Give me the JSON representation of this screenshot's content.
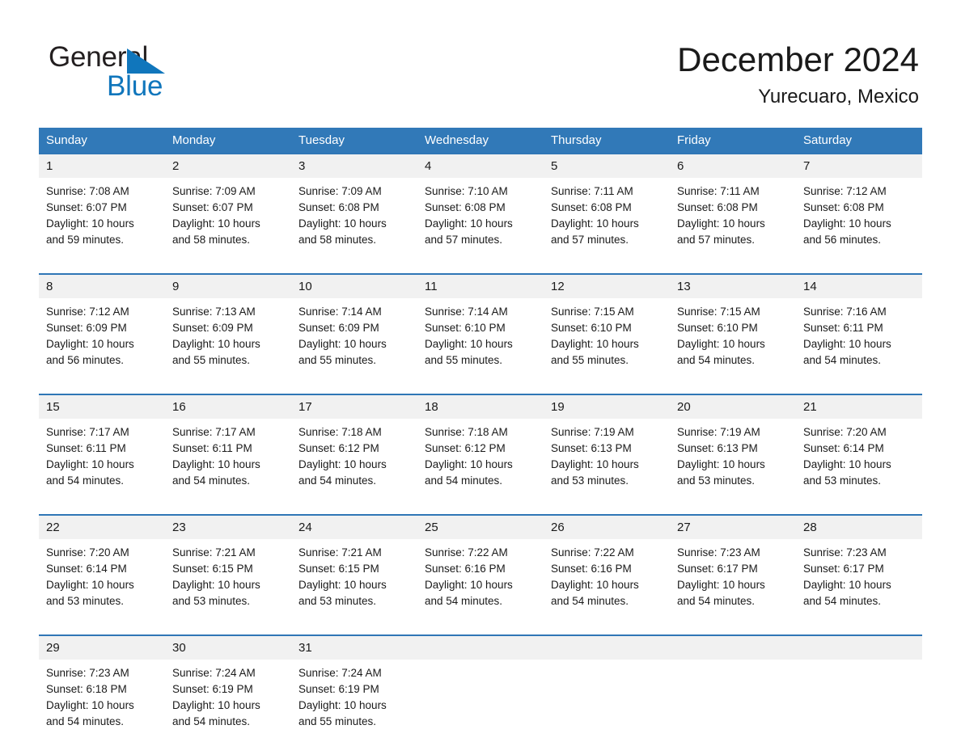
{
  "brand": {
    "name_top": "General",
    "name_bottom": "Blue",
    "color_primary": "#1076bc",
    "color_text": "#231f20"
  },
  "header": {
    "title": "December 2024",
    "subtitle": "Yurecuaro, Mexico"
  },
  "theme": {
    "header_row_bg": "#3179b8",
    "separator": "#2f76b6",
    "daynum_bg": "#f1f1f1",
    "page_bg": "#ffffff"
  },
  "weekdays": [
    "Sunday",
    "Monday",
    "Tuesday",
    "Wednesday",
    "Thursday",
    "Friday",
    "Saturday"
  ],
  "weeks": [
    [
      {
        "day": "1",
        "sunrise": "Sunrise: 7:08 AM",
        "sunset": "Sunset: 6:07 PM",
        "daylight1": "Daylight: 10 hours",
        "daylight2": "and 59 minutes."
      },
      {
        "day": "2",
        "sunrise": "Sunrise: 7:09 AM",
        "sunset": "Sunset: 6:07 PM",
        "daylight1": "Daylight: 10 hours",
        "daylight2": "and 58 minutes."
      },
      {
        "day": "3",
        "sunrise": "Sunrise: 7:09 AM",
        "sunset": "Sunset: 6:08 PM",
        "daylight1": "Daylight: 10 hours",
        "daylight2": "and 58 minutes."
      },
      {
        "day": "4",
        "sunrise": "Sunrise: 7:10 AM",
        "sunset": "Sunset: 6:08 PM",
        "daylight1": "Daylight: 10 hours",
        "daylight2": "and 57 minutes."
      },
      {
        "day": "5",
        "sunrise": "Sunrise: 7:11 AM",
        "sunset": "Sunset: 6:08 PM",
        "daylight1": "Daylight: 10 hours",
        "daylight2": "and 57 minutes."
      },
      {
        "day": "6",
        "sunrise": "Sunrise: 7:11 AM",
        "sunset": "Sunset: 6:08 PM",
        "daylight1": "Daylight: 10 hours",
        "daylight2": "and 57 minutes."
      },
      {
        "day": "7",
        "sunrise": "Sunrise: 7:12 AM",
        "sunset": "Sunset: 6:08 PM",
        "daylight1": "Daylight: 10 hours",
        "daylight2": "and 56 minutes."
      }
    ],
    [
      {
        "day": "8",
        "sunrise": "Sunrise: 7:12 AM",
        "sunset": "Sunset: 6:09 PM",
        "daylight1": "Daylight: 10 hours",
        "daylight2": "and 56 minutes."
      },
      {
        "day": "9",
        "sunrise": "Sunrise: 7:13 AM",
        "sunset": "Sunset: 6:09 PM",
        "daylight1": "Daylight: 10 hours",
        "daylight2": "and 55 minutes."
      },
      {
        "day": "10",
        "sunrise": "Sunrise: 7:14 AM",
        "sunset": "Sunset: 6:09 PM",
        "daylight1": "Daylight: 10 hours",
        "daylight2": "and 55 minutes."
      },
      {
        "day": "11",
        "sunrise": "Sunrise: 7:14 AM",
        "sunset": "Sunset: 6:10 PM",
        "daylight1": "Daylight: 10 hours",
        "daylight2": "and 55 minutes."
      },
      {
        "day": "12",
        "sunrise": "Sunrise: 7:15 AM",
        "sunset": "Sunset: 6:10 PM",
        "daylight1": "Daylight: 10 hours",
        "daylight2": "and 55 minutes."
      },
      {
        "day": "13",
        "sunrise": "Sunrise: 7:15 AM",
        "sunset": "Sunset: 6:10 PM",
        "daylight1": "Daylight: 10 hours",
        "daylight2": "and 54 minutes."
      },
      {
        "day": "14",
        "sunrise": "Sunrise: 7:16 AM",
        "sunset": "Sunset: 6:11 PM",
        "daylight1": "Daylight: 10 hours",
        "daylight2": "and 54 minutes."
      }
    ],
    [
      {
        "day": "15",
        "sunrise": "Sunrise: 7:17 AM",
        "sunset": "Sunset: 6:11 PM",
        "daylight1": "Daylight: 10 hours",
        "daylight2": "and 54 minutes."
      },
      {
        "day": "16",
        "sunrise": "Sunrise: 7:17 AM",
        "sunset": "Sunset: 6:11 PM",
        "daylight1": "Daylight: 10 hours",
        "daylight2": "and 54 minutes."
      },
      {
        "day": "17",
        "sunrise": "Sunrise: 7:18 AM",
        "sunset": "Sunset: 6:12 PM",
        "daylight1": "Daylight: 10 hours",
        "daylight2": "and 54 minutes."
      },
      {
        "day": "18",
        "sunrise": "Sunrise: 7:18 AM",
        "sunset": "Sunset: 6:12 PM",
        "daylight1": "Daylight: 10 hours",
        "daylight2": "and 54 minutes."
      },
      {
        "day": "19",
        "sunrise": "Sunrise: 7:19 AM",
        "sunset": "Sunset: 6:13 PM",
        "daylight1": "Daylight: 10 hours",
        "daylight2": "and 53 minutes."
      },
      {
        "day": "20",
        "sunrise": "Sunrise: 7:19 AM",
        "sunset": "Sunset: 6:13 PM",
        "daylight1": "Daylight: 10 hours",
        "daylight2": "and 53 minutes."
      },
      {
        "day": "21",
        "sunrise": "Sunrise: 7:20 AM",
        "sunset": "Sunset: 6:14 PM",
        "daylight1": "Daylight: 10 hours",
        "daylight2": "and 53 minutes."
      }
    ],
    [
      {
        "day": "22",
        "sunrise": "Sunrise: 7:20 AM",
        "sunset": "Sunset: 6:14 PM",
        "daylight1": "Daylight: 10 hours",
        "daylight2": "and 53 minutes."
      },
      {
        "day": "23",
        "sunrise": "Sunrise: 7:21 AM",
        "sunset": "Sunset: 6:15 PM",
        "daylight1": "Daylight: 10 hours",
        "daylight2": "and 53 minutes."
      },
      {
        "day": "24",
        "sunrise": "Sunrise: 7:21 AM",
        "sunset": "Sunset: 6:15 PM",
        "daylight1": "Daylight: 10 hours",
        "daylight2": "and 53 minutes."
      },
      {
        "day": "25",
        "sunrise": "Sunrise: 7:22 AM",
        "sunset": "Sunset: 6:16 PM",
        "daylight1": "Daylight: 10 hours",
        "daylight2": "and 54 minutes."
      },
      {
        "day": "26",
        "sunrise": "Sunrise: 7:22 AM",
        "sunset": "Sunset: 6:16 PM",
        "daylight1": "Daylight: 10 hours",
        "daylight2": "and 54 minutes."
      },
      {
        "day": "27",
        "sunrise": "Sunrise: 7:23 AM",
        "sunset": "Sunset: 6:17 PM",
        "daylight1": "Daylight: 10 hours",
        "daylight2": "and 54 minutes."
      },
      {
        "day": "28",
        "sunrise": "Sunrise: 7:23 AM",
        "sunset": "Sunset: 6:17 PM",
        "daylight1": "Daylight: 10 hours",
        "daylight2": "and 54 minutes."
      }
    ],
    [
      {
        "day": "29",
        "sunrise": "Sunrise: 7:23 AM",
        "sunset": "Sunset: 6:18 PM",
        "daylight1": "Daylight: 10 hours",
        "daylight2": "and 54 minutes."
      },
      {
        "day": "30",
        "sunrise": "Sunrise: 7:24 AM",
        "sunset": "Sunset: 6:19 PM",
        "daylight1": "Daylight: 10 hours",
        "daylight2": "and 54 minutes."
      },
      {
        "day": "31",
        "sunrise": "Sunrise: 7:24 AM",
        "sunset": "Sunset: 6:19 PM",
        "daylight1": "Daylight: 10 hours",
        "daylight2": "and 55 minutes."
      },
      {
        "day": "",
        "sunrise": "",
        "sunset": "",
        "daylight1": "",
        "daylight2": ""
      },
      {
        "day": "",
        "sunrise": "",
        "sunset": "",
        "daylight1": "",
        "daylight2": ""
      },
      {
        "day": "",
        "sunrise": "",
        "sunset": "",
        "daylight1": "",
        "daylight2": ""
      },
      {
        "day": "",
        "sunrise": "",
        "sunset": "",
        "daylight1": "",
        "daylight2": ""
      }
    ]
  ]
}
